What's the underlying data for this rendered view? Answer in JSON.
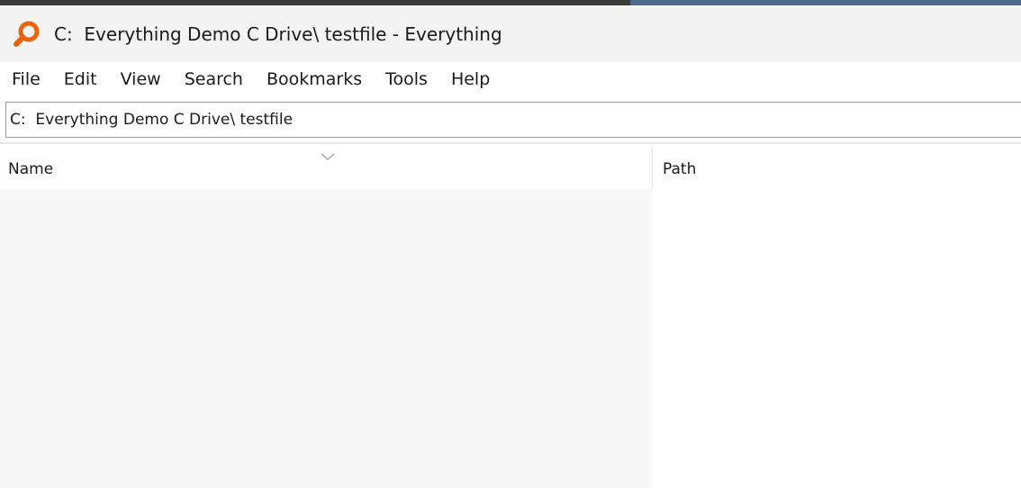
{
  "window": {
    "title": "C:  Everything Demo C Drive\\ testfile - Everything"
  },
  "menu": {
    "items": [
      "File",
      "Edit",
      "View",
      "Search",
      "Bookmarks",
      "Tools",
      "Help"
    ]
  },
  "search": {
    "value": "C:  Everything Demo C Drive\\ testfile"
  },
  "columns": {
    "name": "Name",
    "path": "Path"
  },
  "icons": {
    "app": "magnifier-icon",
    "sort": "chevron-down-icon"
  },
  "colors": {
    "app_icon": "#e8640c"
  }
}
